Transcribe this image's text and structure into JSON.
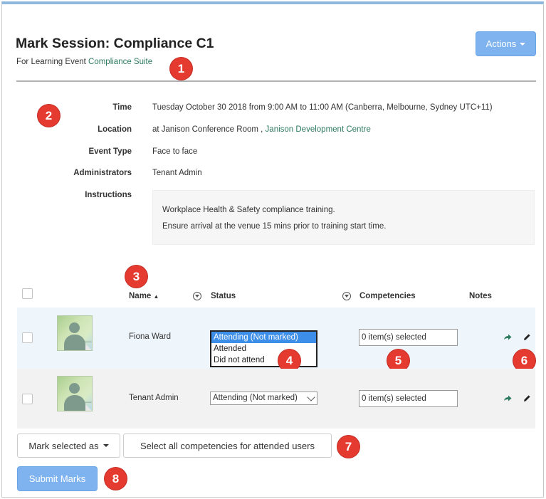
{
  "header": {
    "title": "Mark Session: Compliance C1",
    "subtitle_prefix": "For Learning Event",
    "subtitle_link": "Compliance Suite",
    "actions_label": "Actions"
  },
  "details": {
    "time_label": "Time",
    "time_value": "Tuesday October 30 2018 from 9:00 AM to 11:00 AM (Canberra, Melbourne, Sydney UTC+11)",
    "location_label": "Location",
    "location_prefix": "at Janison Conference Room ,",
    "location_link": "Janison Development Centre",
    "event_type_label": "Event Type",
    "event_type_value": "Face to face",
    "administrators_label": "Administrators",
    "administrators_value": "Tenant Admin",
    "instructions_label": "Instructions",
    "instructions_lines": [
      "Workplace Health & Safety compliance training.",
      "Ensure arrival at the venue 15 mins prior to training start time."
    ]
  },
  "table": {
    "headers": {
      "name": "Name",
      "sort_indicator": "▲",
      "status": "Status",
      "competencies": "Competencies",
      "notes": "Notes"
    },
    "rows": [
      {
        "name": "Fiona Ward",
        "status_options": [
          "Attending (Not marked)",
          "Attended",
          "Did not attend"
        ],
        "competencies": "0 item(s) selected"
      },
      {
        "name": "Tenant Admin",
        "status_selected": "Attending (Not marked)",
        "competencies": "0 item(s) selected"
      }
    ]
  },
  "footer": {
    "mark_selected_label": "Mark selected as",
    "select_all_label": "Select all competencies for attended users",
    "submit_label": "Submit Marks"
  },
  "callouts": [
    "1",
    "2",
    "3",
    "4",
    "5",
    "6",
    "7",
    "8"
  ],
  "colors": {
    "accent_button": "#7fb3f0",
    "link": "#2d7a5f",
    "callout": "#e53a30",
    "selected_option": "#3d8ee8",
    "row_highlight": "#eef6fc",
    "top_bar": "#8fb8df"
  }
}
